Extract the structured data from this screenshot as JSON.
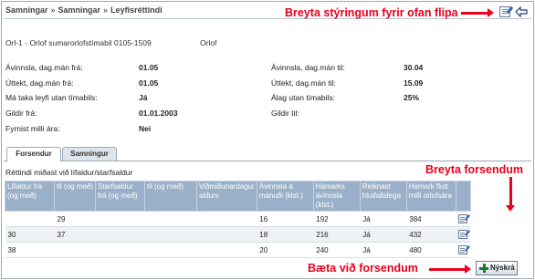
{
  "breadcrumb": [
    "Samningar",
    "Samningar",
    "Leyfisréttindi"
  ],
  "breadcrumb_sep": "»",
  "annotations": {
    "top_right": "Breyta stýringum fyrir ofan flipa",
    "edit_prereq": "Breyta forsendum",
    "add_prereq": "Bæta við forsendum",
    "color": "#e8001c"
  },
  "record": {
    "title": "Orl-1 - Orlof sumarorlofstímabil 0105-1509",
    "type": "Orlof"
  },
  "fields_left": [
    {
      "label": "Ávinnsla, dag.mán frá:",
      "value": "01.05"
    },
    {
      "label": "Úttekt, dag.mán frá:",
      "value": "01.05"
    },
    {
      "label": "Má taka leyfi utan tímabils:",
      "value": "Já"
    },
    {
      "label": "Gildir frá:",
      "value": "01.01.2003"
    },
    {
      "label": "Fyrnist milli ára:",
      "value": "Nei"
    }
  ],
  "fields_right": [
    {
      "label": "Ávinnsla, dag.mán til:",
      "value": "30.04"
    },
    {
      "label": "Úttekt, dag.mán til:",
      "value": "15.09"
    },
    {
      "label": "Álag utan tímabils:",
      "value": "25%"
    },
    {
      "label": "Gildir til:",
      "value": ""
    }
  ],
  "tabs": [
    {
      "label": "Forsendur",
      "active": true
    },
    {
      "label": "Samningur",
      "active": false
    }
  ],
  "table": {
    "caption": "Réttindi miðast við lífaldur/starfsaldur",
    "headers": [
      "Lífaldur frá (og með)",
      "til (og með)",
      "Starfsaldur frá (og með)",
      "til (og með)",
      "Viðmiðunardagur aldurs",
      "Ávinnsla á mánuði (klst.)",
      "Hámarks ávinnsla (klst.)",
      "Reiknast hlutfallslega",
      "Hámark flutt milli orlofsára"
    ],
    "rows": [
      [
        "",
        "29",
        "",
        "",
        "",
        "16",
        "192",
        "Já",
        "384"
      ],
      [
        "30",
        "37",
        "",
        "",
        "",
        "18",
        "216",
        "Já",
        "432"
      ],
      [
        "38",
        "",
        "",
        "",
        "",
        "20",
        "240",
        "Já",
        "480"
      ]
    ]
  },
  "buttons": {
    "new_label": "Nýskrá"
  },
  "icons": {
    "edit_top": "edit-icon",
    "back": "back-arrow-icon",
    "row_edit": "edit-icon",
    "new": "plus-icon"
  }
}
